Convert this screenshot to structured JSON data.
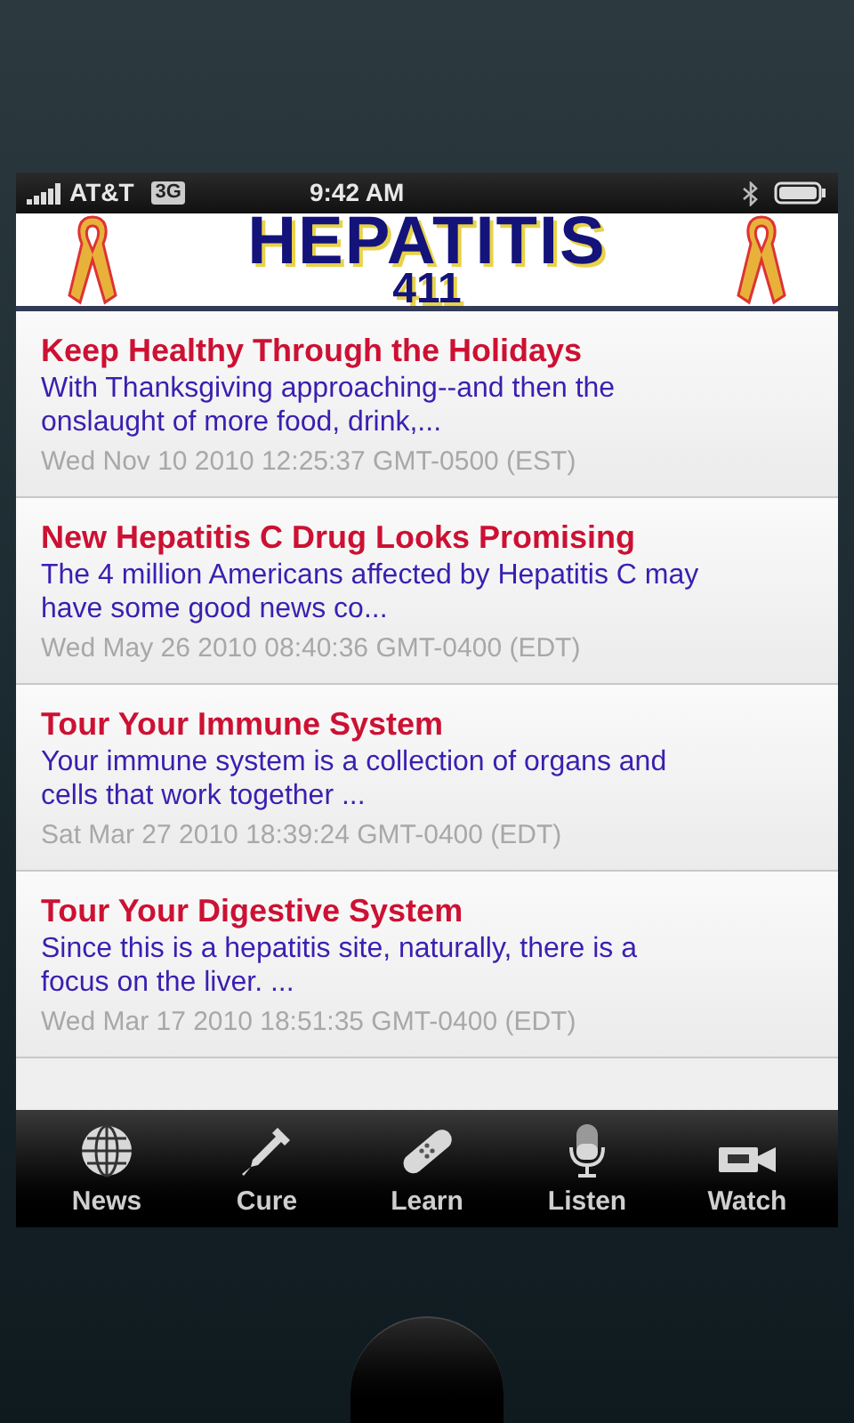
{
  "status_bar": {
    "carrier": "AT&T",
    "network": "3G",
    "time": "9:42 AM"
  },
  "header": {
    "title": "HEPATITIS",
    "subtitle": "411"
  },
  "articles": [
    {
      "title": "Keep Healthy Through the Holidays",
      "summary": "With Thanksgiving approaching--and then the onslaught of more food, drink,...",
      "date": "Wed Nov 10 2010 12:25:37 GMT-0500 (EST)"
    },
    {
      "title": "New Hepatitis C Drug Looks Promising",
      "summary": "The 4 million Americans affected by Hepatitis C may have some good news co...",
      "date": "Wed May 26 2010 08:40:36 GMT-0400 (EDT)"
    },
    {
      "title": "Tour Your Immune System",
      "summary": "Your immune system is a collection of organs and cells that work together ...",
      "date": "Sat Mar 27 2010 18:39:24 GMT-0400 (EDT)"
    },
    {
      "title": "Tour Your Digestive System",
      "summary": "Since this is a hepatitis site, naturally, there is a focus on the liver. ...",
      "date": "Wed Mar 17 2010 18:51:35 GMT-0400 (EDT)"
    }
  ],
  "tabs": [
    {
      "label": "News",
      "kind": "globe"
    },
    {
      "label": "Cure",
      "kind": "dropper"
    },
    {
      "label": "Learn",
      "kind": "bandage"
    },
    {
      "label": "Listen",
      "kind": "mic"
    },
    {
      "label": "Watch",
      "kind": "camera"
    }
  ]
}
